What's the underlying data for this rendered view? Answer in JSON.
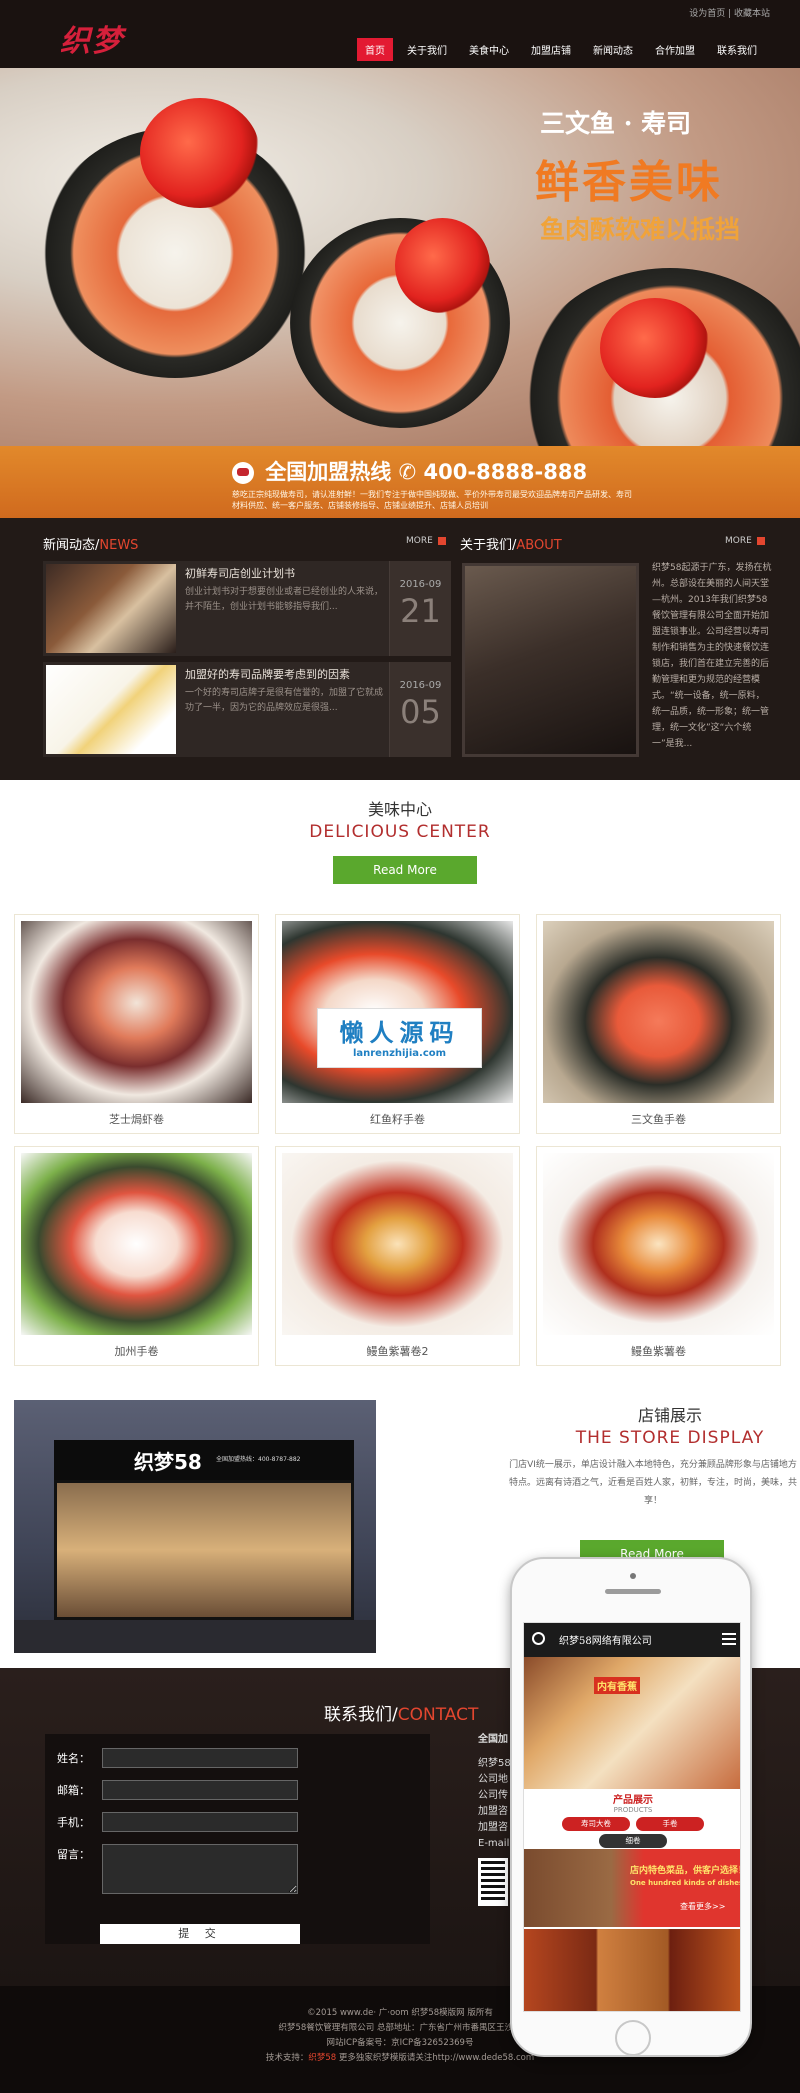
{
  "header": {
    "logo_text": "织梦",
    "toplinks": [
      "设为首页",
      "收藏本站"
    ],
    "nav": [
      "首页",
      "关于我们",
      "美食中心",
      "加盟店铺",
      "新闻动态",
      "合作加盟",
      "联系我们"
    ]
  },
  "banner": {
    "line1": "三文鱼 · 寿司",
    "line2": "鲜香美味",
    "line3": "鱼肉酥软难以抵挡"
  },
  "hotline": {
    "label": "全国加盟热线",
    "phone": "400-8888-888",
    "desc": "慈吃正宗纯现做寿司，请认准射鲜！一我们专注于做中国纯现做、平价外带寿司最受欢迎品牌寿司产品研发、寿司材料供应、统一客户服务、店铺装修指导、店铺业绩提升、店铺人员培训"
  },
  "news": {
    "title_cn": "新闻动态/",
    "title_en": "NEWS",
    "more": "MORE",
    "items": [
      {
        "title": "初鲜寿司店创业计划书",
        "desc": "创业计划书对于想要创业或者已经创业的人来说，并不陌生，创业计划书能够指导我们...",
        "ym": "2016-09",
        "day": "21"
      },
      {
        "title": "加盟好的寿司品牌要考虑到的因素",
        "desc": "一个好的寿司店牌子是很有信誉的，加盟了它就成功了一半，因为它的品牌效应是很强...",
        "ym": "2016-09",
        "day": "05"
      }
    ]
  },
  "about": {
    "title_cn": "关于我们/",
    "title_en": "ABOUT",
    "more": "MORE",
    "text": "织梦58起源于广东，发扬在杭州。总部设在美丽的人间天堂—杭州。2013年我们织梦58餐饮管理有限公司全面开始加盟连锁事业。公司经营以寿司制作和销售为主的快速餐饮连锁店，我们首在建立完善的后勤管理和更为规范的经营模式。“统一设备，统一原料，统一品质，统一形象；统一管理，统一文化”这“六个统一”是我..."
  },
  "center": {
    "title_cn": "美味中心",
    "title_en": "DELICIOUS CENTER",
    "read_more": "Read More",
    "products": [
      "芝士焗虾卷",
      "红鱼籽手卷",
      "三文鱼手卷",
      "加州手卷",
      "鳗鱼紫薯卷2",
      "鳗鱼紫薯卷"
    ]
  },
  "watermark": {
    "cn": "懒人源码",
    "en": "lanrenzhijia.com"
  },
  "store": {
    "title_cn": "店铺展示",
    "title_en": "THE STORE DISPLAY",
    "desc": "门店VI统一展示，单店设计融入本地特色，充分兼顾品牌形象与店铺地方特点。远离有诗酒之气，近看是百姓人家，初鲜，专注，时尚，美味，共享！",
    "read_more": "Read More",
    "sign": "织梦58",
    "sign_small": "全国加盟热线：400-8787-882"
  },
  "contact": {
    "title_cn": "联系我们/",
    "title_en": "CONTACT",
    "labels": [
      "姓名：",
      "邮箱：",
      "手机：",
      "留言："
    ],
    "submit": "提 交",
    "info": [
      "全国加",
      "织梦58",
      "公司地",
      "公司传",
      "加盟咨",
      "加盟咨",
      "E-mail"
    ]
  },
  "footer": {
    "line1": "©2015 www.de· 广·oom 织梦58模版网 版所有",
    "line2": "织梦58餐饮管理有限公司 总部地址：广东省广州市番禺区王沙路",
    "line3": "网站ICP备案号：京ICP备32652369号",
    "line4_pre": "技术支持：",
    "line4_hl": "织梦58",
    "line4_post": " 更多独家织梦模版请关注http://www.dede58.com"
  },
  "phone": {
    "title": "织梦58网络有限公司",
    "banner_tag": "内有香蕉",
    "products_cn": "产品展示",
    "products_en": "PRODUCTS",
    "tabs": [
      "寿司大卷",
      "手卷",
      "细卷"
    ],
    "feature_t1": "店内特色菜品，供客户选择！",
    "feature_t2": "One hundred kinds of dishes",
    "feature_btn": "查看更多>>"
  },
  "colors": {
    "accent": "#e31a32",
    "green": "#5aa82d",
    "orange": "#e2892b",
    "dark": "#221a17"
  }
}
